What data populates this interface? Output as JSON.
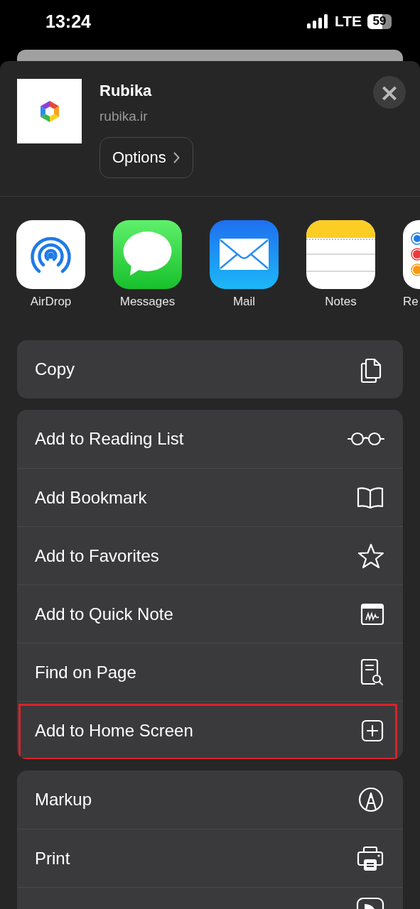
{
  "status_bar": {
    "time": "13:24",
    "network": "LTE",
    "battery": "59"
  },
  "header": {
    "title": "Rubika",
    "subtitle": "rubika.ir",
    "options_button": "Options",
    "close_button": "×"
  },
  "apps": [
    {
      "label": "AirDrop"
    },
    {
      "label": "Messages"
    },
    {
      "label": "Mail"
    },
    {
      "label": "Notes"
    },
    {
      "label": "Re"
    }
  ],
  "action_groups": [
    {
      "items": [
        {
          "label": "Copy",
          "highlighted": false
        }
      ]
    },
    {
      "items": [
        {
          "label": "Add to Reading List",
          "highlighted": false
        },
        {
          "label": "Add Bookmark",
          "highlighted": false
        },
        {
          "label": "Add to Favorites",
          "highlighted": false
        },
        {
          "label": "Add to Quick Note",
          "highlighted": false
        },
        {
          "label": "Find on Page",
          "highlighted": false
        },
        {
          "label": "Add to Home Screen",
          "highlighted": true
        }
      ]
    },
    {
      "items": [
        {
          "label": "Markup",
          "highlighted": false
        },
        {
          "label": "Print",
          "highlighted": false
        }
      ]
    }
  ]
}
